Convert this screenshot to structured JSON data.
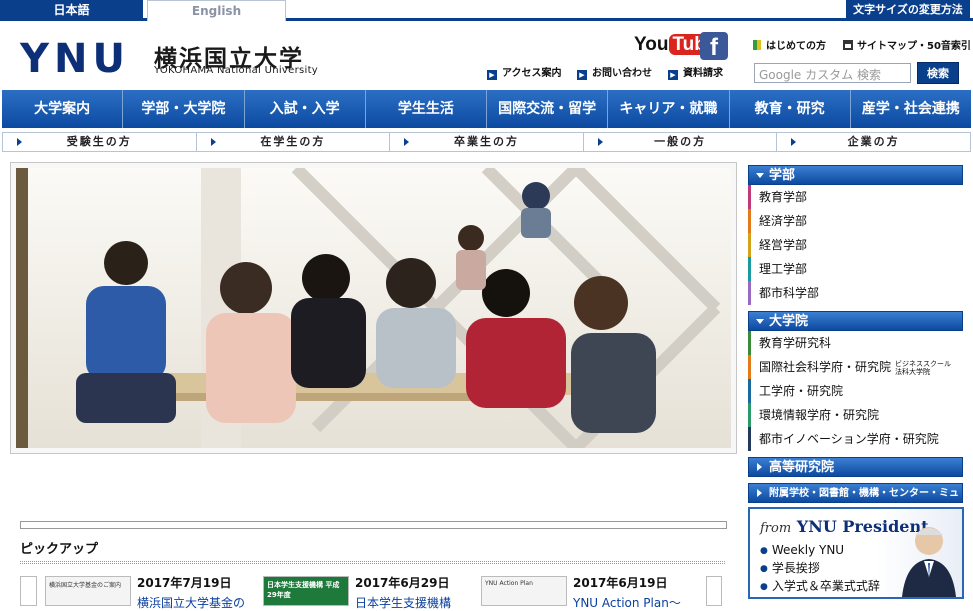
{
  "lang": {
    "japanese": "日本語",
    "english": "English"
  },
  "fontsize_label": "文字サイズの変更方法",
  "logo": {
    "mark": "YNU",
    "name_ja": "横浜国立大学",
    "name_en": "YOKOHAMA National University"
  },
  "social": {
    "youtube_you": "You",
    "youtube_tube": "Tube",
    "facebook": "f"
  },
  "top_links": {
    "first_time": "はじめての方",
    "sitemap": "サイトマップ・50音索引"
  },
  "header_links": {
    "access": "アクセス案内",
    "contact": "お問い合わせ",
    "request": "資料請求"
  },
  "search": {
    "placeholder": "Google カスタム 検索",
    "button": "検索"
  },
  "global_nav": [
    "大学案内",
    "学部・大学院",
    "入試・入学",
    "学生生活",
    "国際交流・留学",
    "キャリア・就職",
    "教育・研究",
    "産学・社会連携"
  ],
  "audience_nav": [
    "受験生の方",
    "在学生の方",
    "卒業生の方",
    "一般の方",
    "企業の方"
  ],
  "sidebar": {
    "faculties_title": "学部",
    "faculties": [
      "教育学部",
      "経済学部",
      "経営学部",
      "理工学部",
      "都市科学部"
    ],
    "grad_title": "大学院",
    "grad": [
      "教育学研究科",
      "国際社会科学府・研究院",
      "工学府・研究院",
      "環境情報学府・研究院",
      "都市イノベーション学府・研究院"
    ],
    "grad_note_1": "ビジネススクール",
    "grad_note_2": "法科大学院",
    "advanced_title": "高等研究院",
    "affiliated_title": "附属学校・図書館・機構・センター・ミュージアム"
  },
  "president": {
    "from": "from",
    "ynu": "YNU",
    "title": "President",
    "items": [
      "Weekly YNU",
      "学長挨拶",
      "入学式＆卒業式式辞"
    ]
  },
  "pickup": {
    "title": "ピックアップ",
    "items": [
      {
        "date": "2017年7月19日",
        "text": "横浜国立大学基金の",
        "thumb": "横浜国立大学基金のご案内"
      },
      {
        "date": "2017年6月29日",
        "text": "日本学生支援機構",
        "thumb": "日本学生支援機構 平成29年度"
      },
      {
        "date": "2017年6月19日",
        "text": "YNU Action Plan～",
        "thumb": "YNU Action Plan"
      }
    ]
  },
  "colors": {
    "brand": "#0a3f8c",
    "nav": "#0c4aa0"
  }
}
